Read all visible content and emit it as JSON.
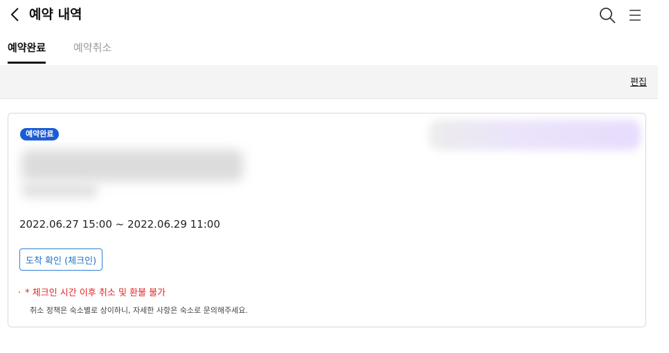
{
  "header": {
    "title": "예약 내역",
    "icons": [
      "chevron-left-icon",
      "search-icon",
      "menu-icon"
    ]
  },
  "tabs": [
    {
      "label": "예약완료",
      "active": true
    },
    {
      "label": "예약취소",
      "active": false
    }
  ],
  "toolbar": {
    "edit_label": "편집"
  },
  "reservation": {
    "status": "예약완료",
    "date_range": "2022.06.27 15:00 ~ 2022.06.29 11:00",
    "checkin_button": "도착 확인 (체크인)",
    "notice": "* 체크인 시간 이후 취소 및 환불 불가",
    "policy": "취소 정책은 숙소별로 상이하니, 자세한 사항은 숙소로 문의해주세요."
  },
  "colors": {
    "accent": "#1a5bd6",
    "button_border": "#2f7fd6",
    "notice": "#e12525",
    "bar_bg": "#f4f4f4"
  }
}
